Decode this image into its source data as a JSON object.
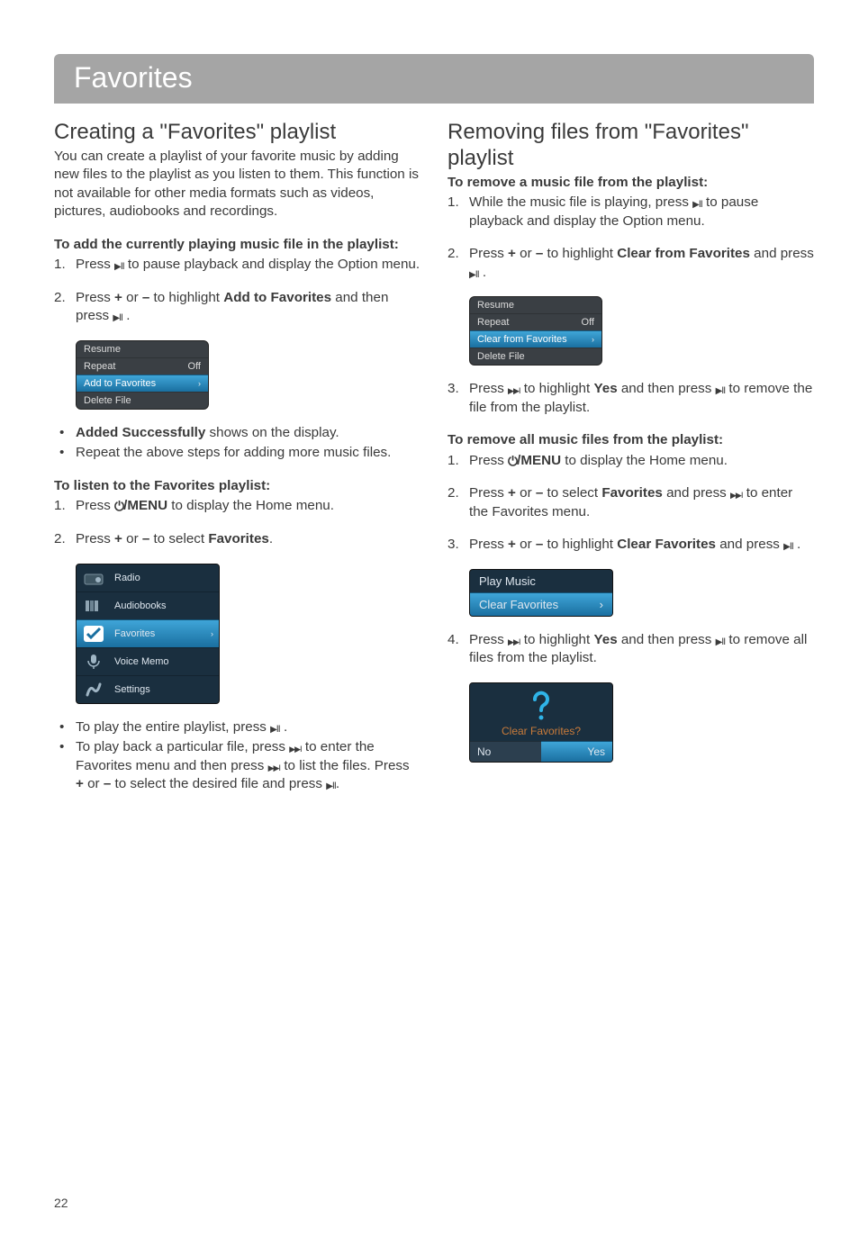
{
  "page": {
    "title": "Favorites",
    "page_number": "22"
  },
  "left": {
    "heading": "Creating a \"Favorites\" playlist",
    "intro": "You can create a playlist of your favorite music by adding new files to the playlist as you listen to them. This function is not available for other media formats such as videos, pictures, audiobooks and recordings.",
    "add_subhead": "To add the currently playing music file in the playlist:",
    "add_step1_a": "Press ",
    "add_step1_b": " to pause playback and display the Option menu.",
    "add_step2_a": "Press ",
    "add_step2_plus": "+",
    "add_step2_or": " or ",
    "add_step2_minus": "–",
    "add_step2_b": " to highlight ",
    "add_step2_bold": "Add to Favorites",
    "add_step2_c": " and then press ",
    "add_step2_d": " .",
    "option_menu": {
      "resume": "Resume",
      "repeat": "Repeat",
      "repeat_value": "Off",
      "add": "Add to Favorites",
      "delete": "Delete File"
    },
    "bullet1_bold": "Added Successfully",
    "bullet1_rest": " shows on the display.",
    "bullet2": "Repeat the above steps for adding more music files.",
    "listen_subhead": "To listen to the Favorites playlist:",
    "listen_step1_a": "Press ",
    "listen_step1_bold": "/MENU",
    "listen_step1_b": " to display the Home menu.",
    "listen_step2_a": "Press ",
    "listen_step2_b": " to select ",
    "listen_step2_bold": "Favorites",
    "listen_step2_c": ".",
    "home_menu": {
      "radio": "Radio",
      "audiobooks": "Audiobooks",
      "favorites": "Favorites",
      "voice": "Voice Memo",
      "settings": "Settings"
    },
    "play_bullet1_a": "To play the entire playlist, press ",
    "play_bullet1_b": " .",
    "play_bullet2_a": "To play back a particular file, press ",
    "play_bullet2_b": " to enter the Favorites menu and then press ",
    "play_bullet2_c": " to list the files. Press ",
    "play_bullet2_d": " to select the desired file and press ",
    "play_bullet2_e": "."
  },
  "right": {
    "heading": "Removing files from \"Favorites\" playlist",
    "remove_one_subhead": "To remove a music file from the playlist:",
    "r1_step1_a": "While the music file is playing, press ",
    "r1_step1_b": " to pause playback and display the Option menu.",
    "r1_step2_a": "Press ",
    "r1_step2_b": " to highlight ",
    "r1_step2_bold": "Clear from Favorites",
    "r1_step2_c": " and press ",
    "r1_step2_d": " .",
    "option_menu2": {
      "resume": "Resume",
      "repeat": "Repeat",
      "repeat_value": "Off",
      "clear": "Clear from Favorites",
      "delete": "Delete File"
    },
    "r1_step3_a": "Press ",
    "r1_step3_b": " to highlight ",
    "r1_step3_bold": "Yes",
    "r1_step3_c": " and then press ",
    "r1_step3_d": " to remove the file from the playlist.",
    "remove_all_subhead": "To remove all music files from the playlist:",
    "ra_step1_a": "Press ",
    "ra_step1_bold": "/MENU",
    "ra_step1_b": " to display the Home menu.",
    "ra_step2_a": "Press ",
    "ra_step2_b": " to select ",
    "ra_step2_bold": "Favorites",
    "ra_step2_c": " and press ",
    "ra_step2_d": " to enter the Favorites menu.",
    "ra_step3_a": "Press ",
    "ra_step3_b": " to highlight ",
    "ra_step3_bold": "Clear Favorites",
    "ra_step3_c": " and press ",
    "ra_step3_d": " .",
    "playclear": {
      "play": "Play Music",
      "clear": "Clear Favorites"
    },
    "ra_step4_a": "Press ",
    "ra_step4_b": " to highlight ",
    "ra_step4_bold": "Yes",
    "ra_step4_c": " and then press ",
    "ra_step4_d": " to remove all files from the playlist.",
    "confirm": {
      "label": "Clear Favorites?",
      "no": "No",
      "yes": "Yes"
    }
  }
}
